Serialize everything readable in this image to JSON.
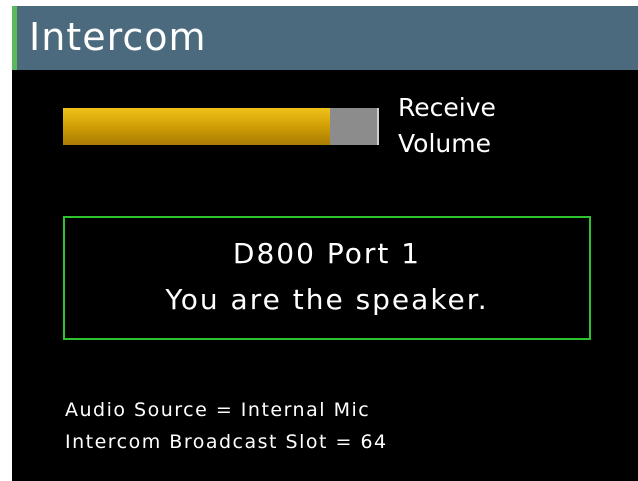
{
  "window": {
    "title": "Intercom"
  },
  "volume": {
    "label_line1": "Receive",
    "label_line2": "Volume",
    "level_percent": 85
  },
  "status": {
    "line1": "D800 Port 1",
    "line2": "You are the speaker."
  },
  "info": {
    "audio_source": "Audio Source = Internal Mic",
    "broadcast_slot": "Intercom Broadcast Slot = 64"
  },
  "colors": {
    "titlebar": "#4b6a7e",
    "accent_green": "#2fc22f",
    "volume_fill": "#d4a207",
    "background": "#000000"
  }
}
